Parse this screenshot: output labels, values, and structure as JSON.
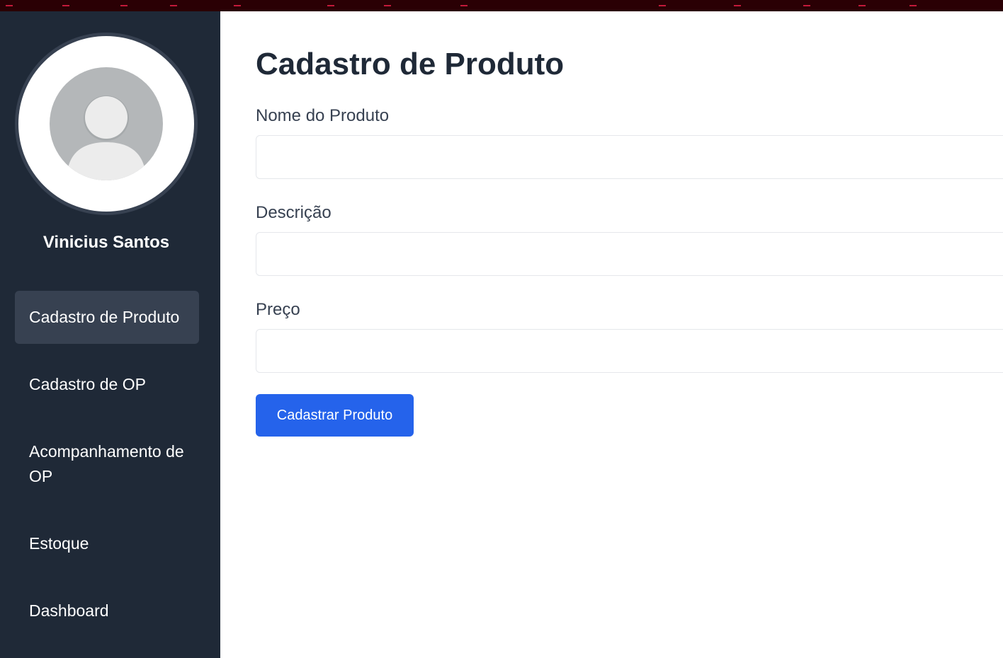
{
  "colors": {
    "sidebar_bg": "#1f2937",
    "active_item_bg": "#374151",
    "accent": "#2563eb",
    "title_text": "#1f2937"
  },
  "user": {
    "name": "Vinicius Santos",
    "avatar_icon": "user-avatar-icon"
  },
  "sidebar": {
    "items": [
      {
        "label": "Cadastro de Produto",
        "active": true
      },
      {
        "label": "Cadastro de OP",
        "active": false
      },
      {
        "label": "Acompanhamento de OP",
        "active": false
      },
      {
        "label": "Estoque",
        "active": false
      },
      {
        "label": "Dashboard",
        "active": false
      }
    ]
  },
  "main": {
    "title": "Cadastro de Produto",
    "fields": [
      {
        "label": "Nome do Produto",
        "value": "",
        "placeholder": ""
      },
      {
        "label": "Descrição",
        "value": "",
        "placeholder": ""
      },
      {
        "label": "Preço",
        "value": "",
        "placeholder": ""
      }
    ],
    "submit_label": "Cadastrar Produto"
  }
}
